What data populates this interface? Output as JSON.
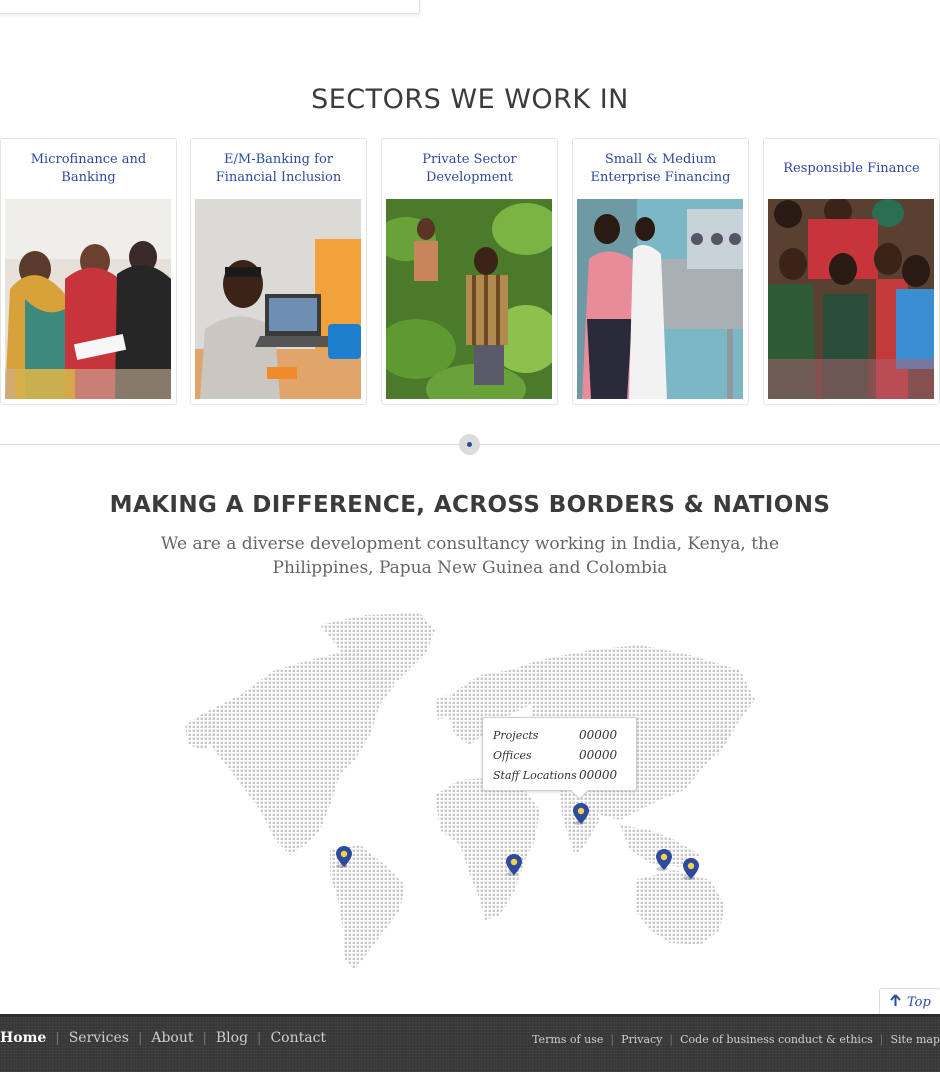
{
  "sectors": {
    "title": "SECTORS WE WORK IN",
    "cards": [
      {
        "title": "Microfinance and Banking"
      },
      {
        "title": "E/M-Banking for Financial Inclusion"
      },
      {
        "title": "Private Sector Development"
      },
      {
        "title": "Small & Medium Enterprise Financing"
      },
      {
        "title": "Responsible Finance"
      }
    ]
  },
  "difference": {
    "title": "MAKING A DIFFERENCE, ACROSS BORDERS & NATIONS",
    "subtitle": "We are a diverse development consultancy working in India, Kenya, the Philippines, Papua New Guinea and Colombia"
  },
  "map_tooltip": {
    "rows": [
      {
        "label": "Projects",
        "value": "00000"
      },
      {
        "label": "Offices",
        "value": "00000"
      },
      {
        "label": "Staff Locations",
        "value": "00000"
      }
    ]
  },
  "top_button": {
    "label": "Top"
  },
  "footer": {
    "nav": [
      {
        "label": "Home"
      },
      {
        "label": "Services"
      },
      {
        "label": "About"
      },
      {
        "label": "Blog"
      },
      {
        "label": "Contact"
      }
    ],
    "links": [
      {
        "label": "Terms of use"
      },
      {
        "label": "Privacy"
      },
      {
        "label": "Code of business conduct & ethics"
      },
      {
        "label": "Site map"
      }
    ]
  },
  "colors": {
    "accent": "#2d4aa0",
    "footer_bg": "#3a3a3a",
    "heading": "#3b3b3b"
  }
}
